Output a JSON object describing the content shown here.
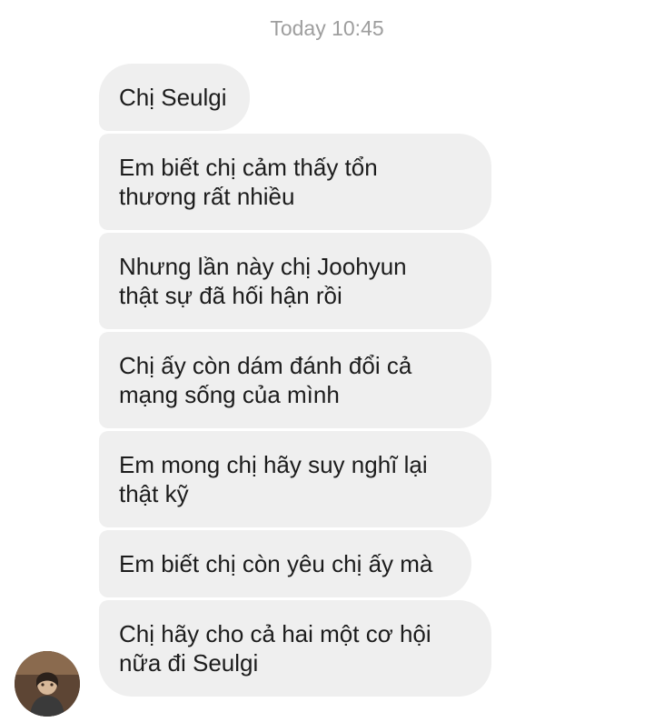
{
  "thread": {
    "timestamp": "Today 10:45",
    "messages": [
      {
        "text": "Chị Seulgi"
      },
      {
        "text": "Em biết chị cảm thấy tổn\nthương rất nhiều"
      },
      {
        "text": "Nhưng lần này chị Joohyun\nthật sự đã hối hận rồi"
      },
      {
        "text": "Chị ấy còn dám đánh đổi cả\nmạng sống của mình"
      },
      {
        "text": "Em mong chị hãy suy nghĩ lại\nthật kỹ"
      },
      {
        "text": "Em biết chị còn yêu chị ấy mà"
      },
      {
        "text": "Chị hãy cho cả hai một cơ hội\nnữa đi Seulgi"
      }
    ]
  },
  "sender": {
    "avatar_icon": "contact-avatar"
  },
  "colors": {
    "bubble_background": "#efefef",
    "text": "#1c1c1c",
    "timestamp": "#9e9e9e"
  }
}
